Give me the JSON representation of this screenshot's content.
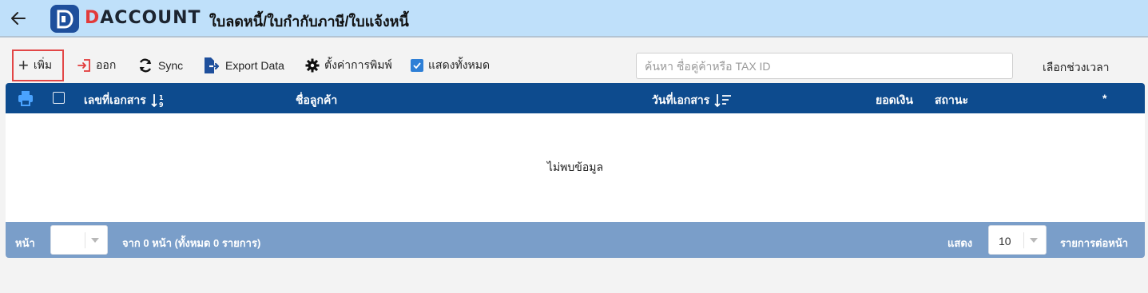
{
  "header": {
    "logo_d": "D",
    "logo_rest": "ACCOUNT",
    "title": "ใบลดหนี้/ใบกำกับภาษี/ใบแจ้งหนี้"
  },
  "toolbar": {
    "add_label": "เพิ่ม",
    "exit_label": "ออก",
    "sync_label": "Sync",
    "export_label": "Export Data",
    "print_settings_label": "ตั้งค่าการพิมพ์",
    "show_all_label": "แสดงทั้งหมด",
    "show_all_checked": true,
    "search_placeholder": "ค้นหา ชื่อคู่ค้าหรือ TAX ID",
    "period_label": "เลือกช่วงเวลา"
  },
  "table": {
    "columns": {
      "doc_no": "เลขที่เอกสาร",
      "customer": "ชื่อลูกค้า",
      "doc_date": "วันที่เอกสาร",
      "amount": "ยอดเงิน",
      "status": "สถานะ",
      "action": "*"
    },
    "empty_message": "ไม่พบข้อมูล"
  },
  "footer": {
    "page_label": "หน้า",
    "page_value": "",
    "page_info": "จาก 0 หน้า (ทั้งหมด 0 รายการ)",
    "show_label": "แสดง",
    "per_page_value": "10",
    "per_page_label": "รายการต่อหน้า"
  },
  "colors": {
    "header_bg": "#bfe0fa",
    "table_header_bg": "#0d4b8e",
    "footer_bg": "#7a9ec9",
    "accent_red": "#e23a3a",
    "checkbox_blue": "#2e7fd6"
  }
}
